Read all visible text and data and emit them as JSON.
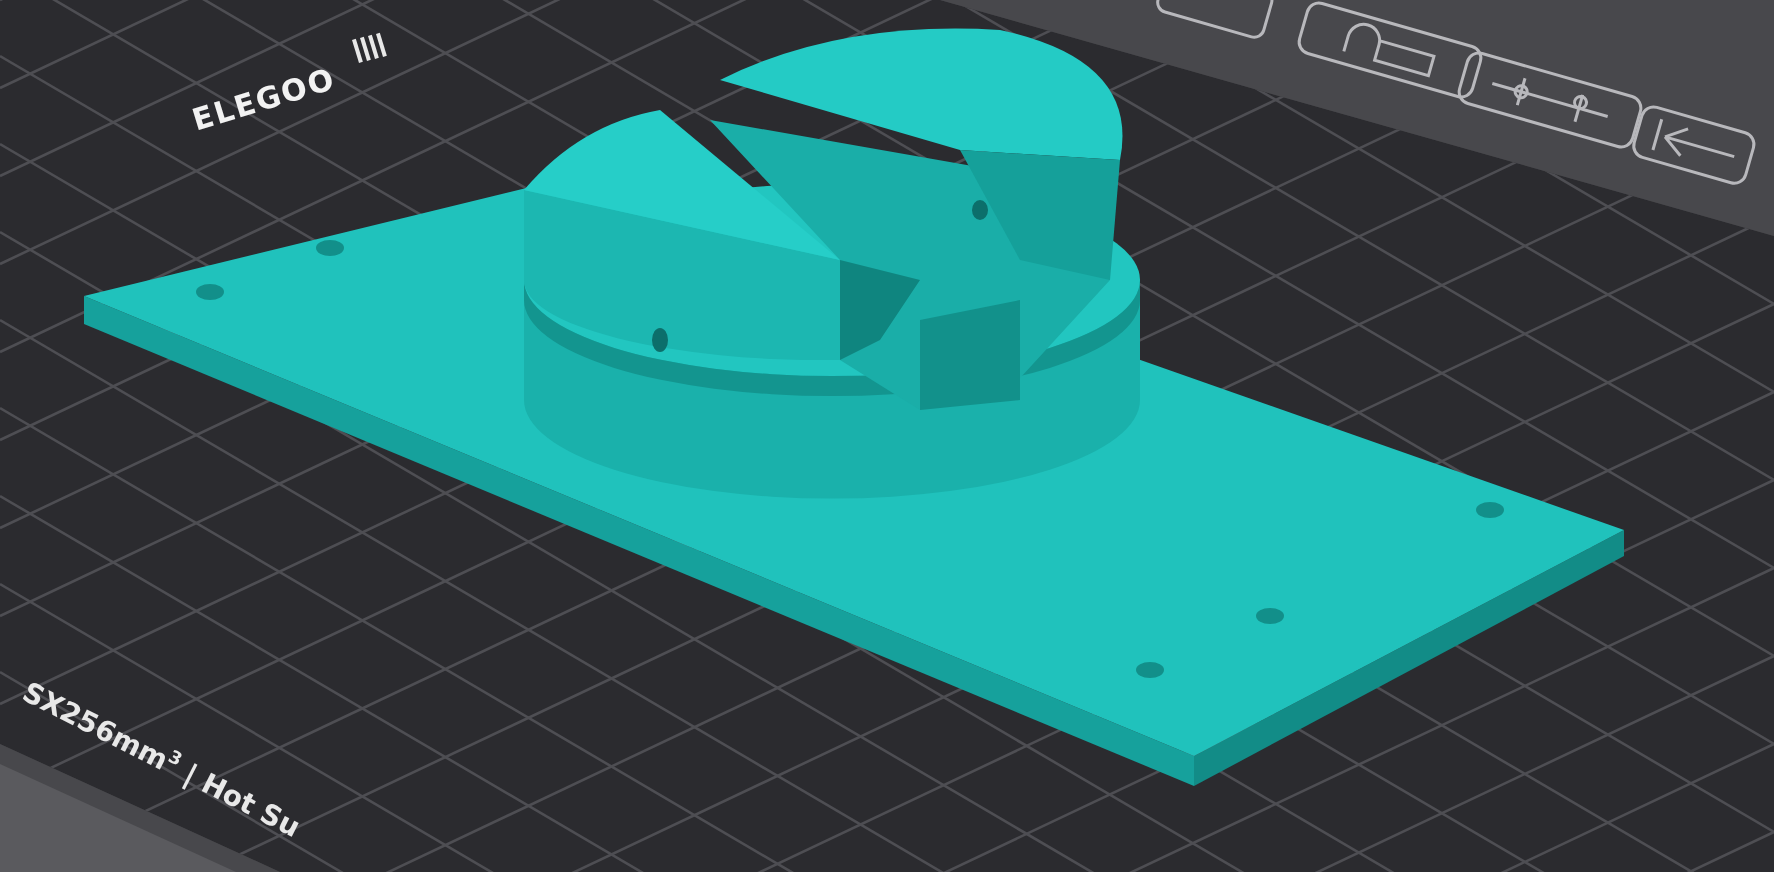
{
  "bed": {
    "logo": "ELEGOO",
    "label": "SX256mm$^{3}$ | Hot Su"
  }
}
